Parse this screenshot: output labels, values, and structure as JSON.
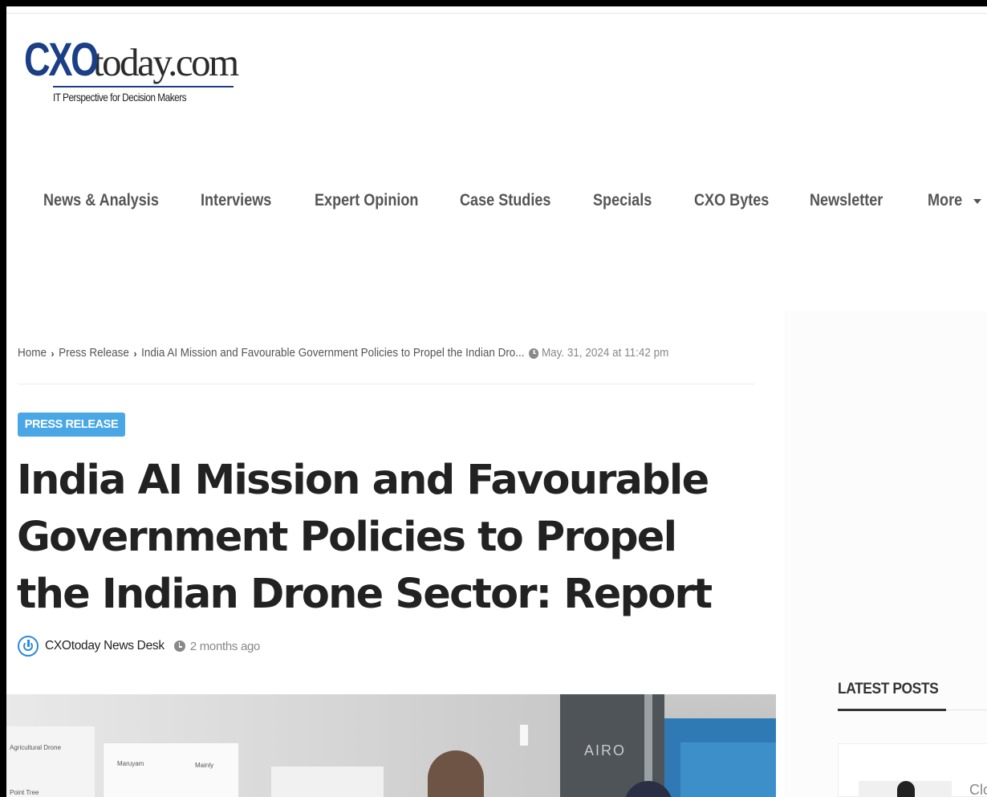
{
  "logo": {
    "cxo": "CXO",
    "today": "today.com",
    "tagline": "IT Perspective for Decision Makers"
  },
  "nav": {
    "items": [
      "News & Analysis",
      "Interviews",
      "Expert Opinion",
      "Case Studies",
      "Specials",
      "CXO Bytes",
      "Newsletter",
      "More"
    ]
  },
  "breadcrumb": {
    "home": "Home",
    "section": "Press Release",
    "current": "India AI Mission and Favourable Government Policies to Propel the Indian Dro...",
    "date": "May. 31, 2024 at 11:42 pm"
  },
  "article": {
    "category": "PRESS RELEASE",
    "title": "India AI Mission and Favourable Government Policies to Propel the Indian Drone Sector: Report",
    "author": "CXOtoday News Desk",
    "time_ago": "2 months ago"
  },
  "sidebar": {
    "latest_posts_heading": "LATEST POSTS",
    "first_post_snippet": "Clo"
  },
  "image_text": {
    "label1": "Agricultural Drone",
    "label2": "Maruyam",
    "label3": "Mainly",
    "label4": "Point Tree",
    "sign": "AIRO"
  },
  "colors": {
    "brand_blue": "#1a3f86",
    "badge_blue": "#4aa7e6",
    "nav_text": "#555555",
    "title_text": "#222222"
  }
}
